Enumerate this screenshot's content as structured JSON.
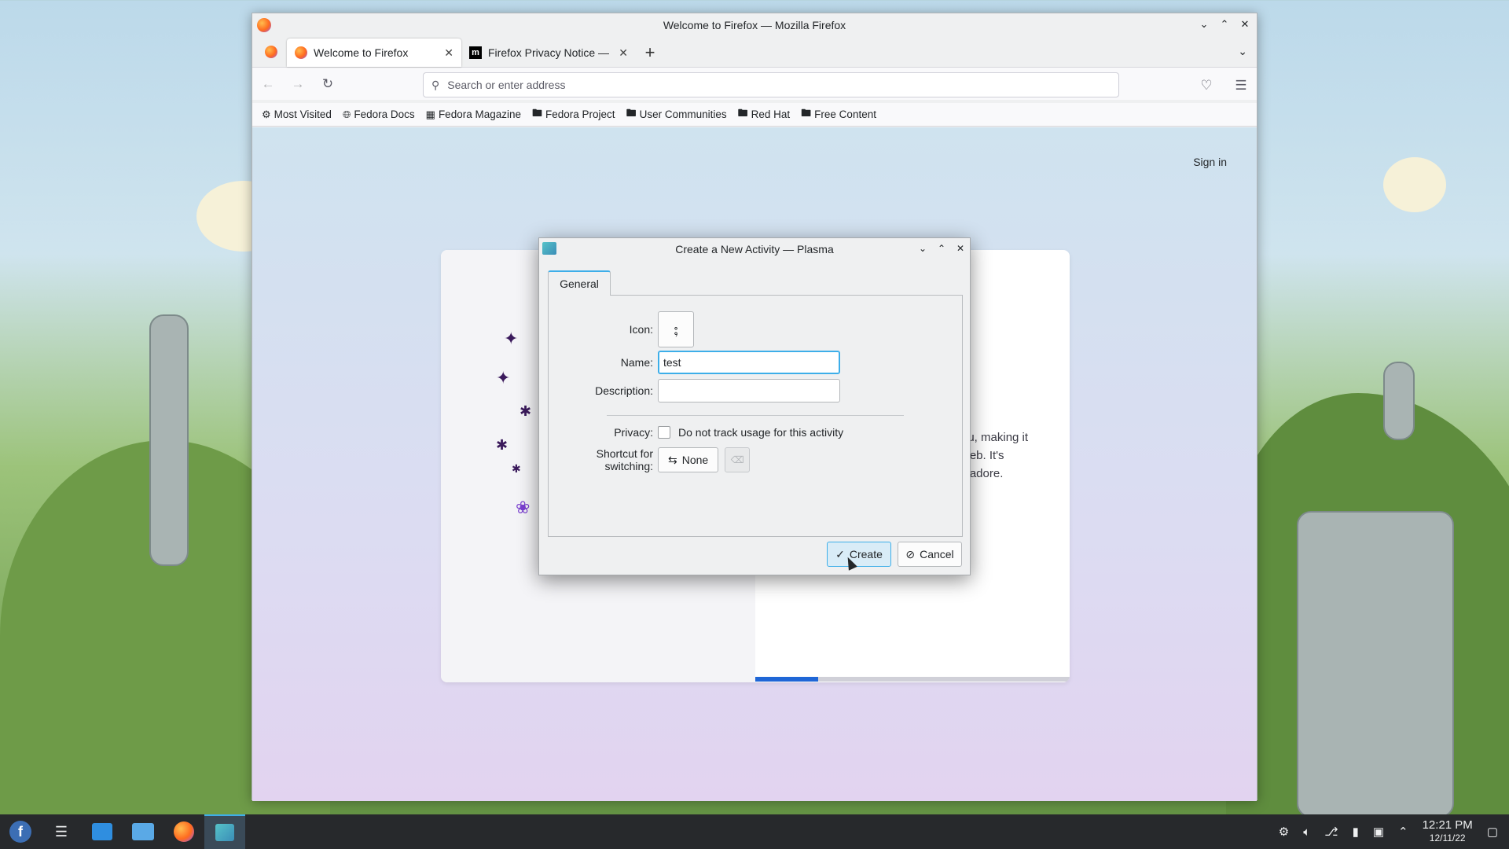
{
  "firefox": {
    "window_title": "Welcome to Firefox — Mozilla Firefox",
    "tabs": [
      {
        "label": "Welcome to Firefox",
        "active": true
      },
      {
        "label": "Firefox Privacy Notice — M",
        "active": false
      }
    ],
    "address_placeholder": "Search or enter address",
    "bookmarks": [
      {
        "label": "Most Visited",
        "icon": "gear-icon"
      },
      {
        "label": "Fedora Docs",
        "icon": "globe-icon"
      },
      {
        "label": "Fedora Magazine",
        "icon": "magazine-icon"
      },
      {
        "label": "Fedora Project",
        "icon": "folder-icon"
      },
      {
        "label": "User Communities",
        "icon": "folder-icon"
      },
      {
        "label": "Red Hat",
        "icon": "folder-icon"
      },
      {
        "label": "Free Content",
        "icon": "folder-icon"
      }
    ],
    "page": {
      "sign_in": "Sign in",
      "text_lines": [
        "ou, making it",
        "web. It's",
        "ll adore."
      ],
      "progress_fraction": 0.2
    }
  },
  "dialog": {
    "title": "Create a New Activity — Plasma",
    "tab_general": "General",
    "icon_label": "Icon:",
    "name_label": "Name:",
    "name_value": "test",
    "description_label": "Description:",
    "description_value": "",
    "privacy_label": "Privacy:",
    "privacy_checkbox_label": "Do not track usage for this activity",
    "privacy_checked": false,
    "shortcut_label": "Shortcut for switching:",
    "shortcut_value": "None",
    "create_label": "Create",
    "cancel_label": "Cancel"
  },
  "taskbar": {
    "time": "12:21 PM",
    "date": "12/11/22"
  },
  "colors": {
    "accent": "#3daee9",
    "progress": "#1f66d6",
    "taskbar": "#27292c"
  }
}
